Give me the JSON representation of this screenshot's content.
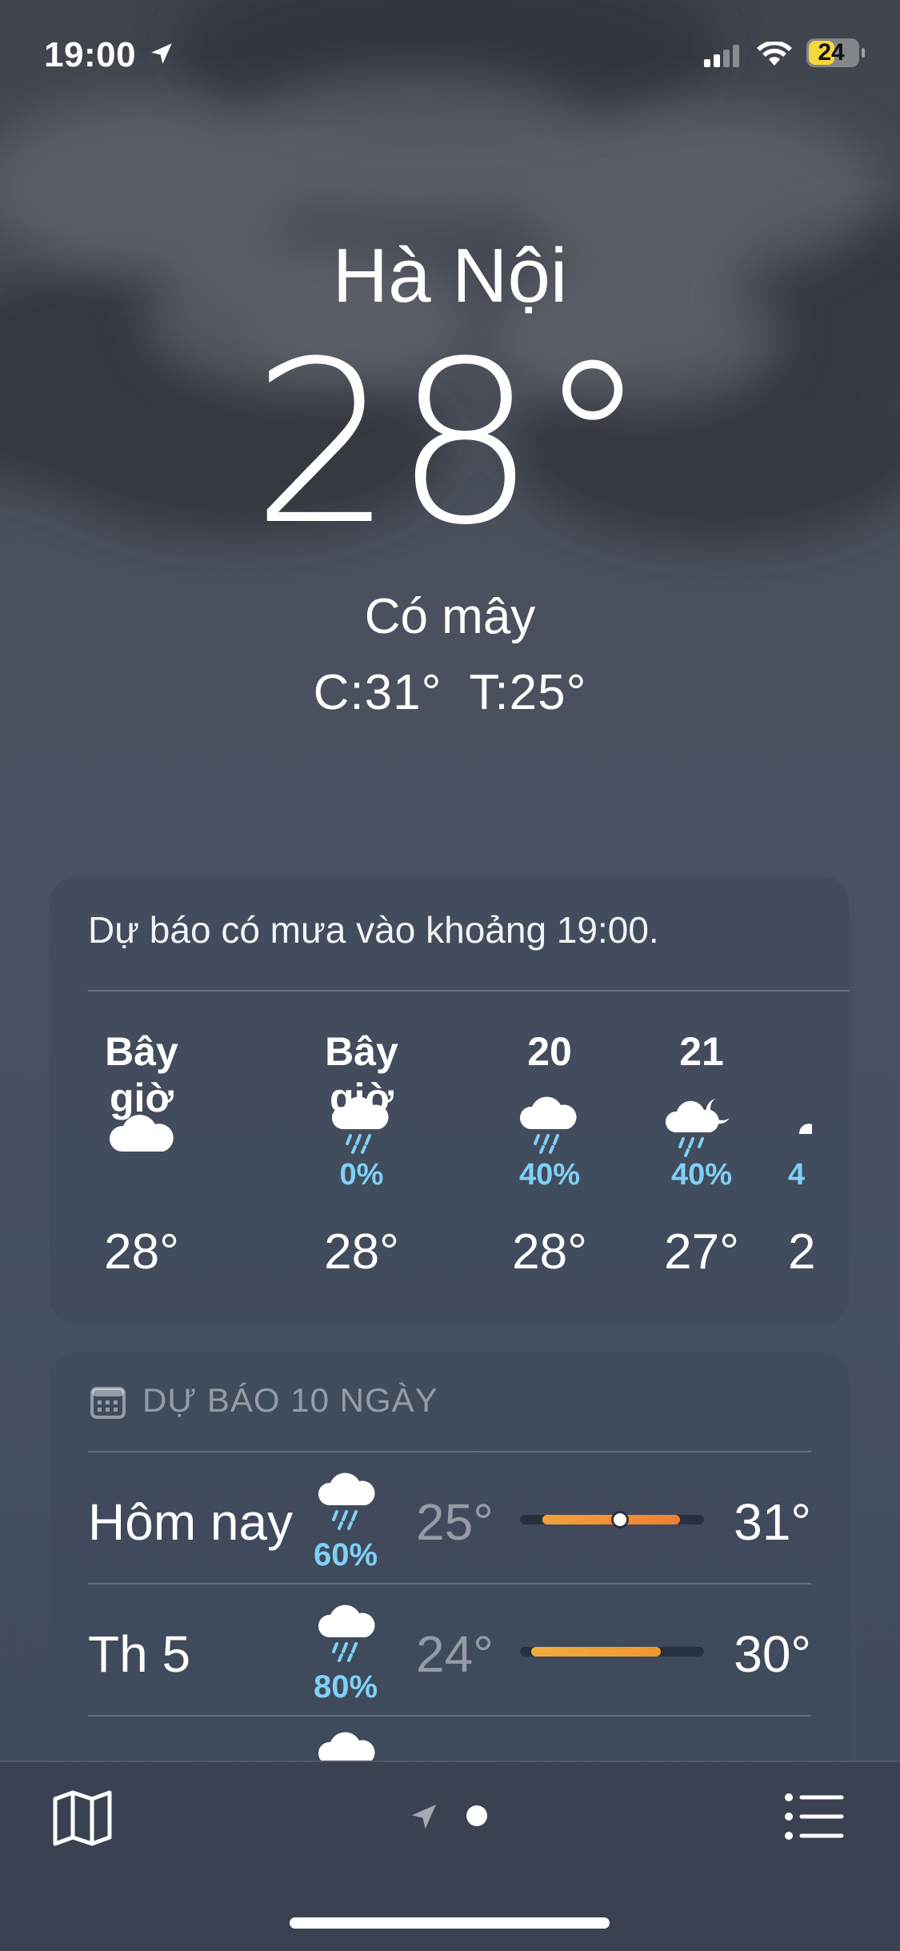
{
  "status_bar": {
    "time": "19:00",
    "battery": "24"
  },
  "location": {
    "city": "Hà Nội",
    "temperature": "28°",
    "condition": "Có mây",
    "high": "C:31°",
    "low": "T:25°"
  },
  "hourly_card": {
    "summary": "Dự báo có mưa vào khoảng 19:00.",
    "hours": [
      {
        "label": "Bây giờ",
        "icon": "cloud-icon",
        "precip": "",
        "temp": "28°"
      },
      {
        "label": "Bây giờ",
        "icon": "cloud-rain-icon",
        "precip": "0%",
        "temp": "28°"
      },
      {
        "label": "20",
        "icon": "cloud-rain-icon",
        "precip": "40%",
        "temp": "28°"
      },
      {
        "label": "21",
        "icon": "cloud-moon-rain-icon",
        "precip": "40%",
        "temp": "27°"
      },
      {
        "label": "",
        "icon": "cloud-moon-rain-icon",
        "precip": "4",
        "temp": "2"
      }
    ]
  },
  "daily_card": {
    "title": "DỰ BÁO 10 NGÀY",
    "days": [
      {
        "day": "Hôm nay",
        "icon": "cloud-rain-icon",
        "precip": "60%",
        "low": "25°",
        "high": "31°",
        "has_current_dot": true
      },
      {
        "day": "Th 5",
        "icon": "cloud-rain-icon",
        "precip": "80%",
        "low": "24°",
        "high": "30°",
        "has_current_dot": false
      },
      {
        "day": "",
        "icon": "cloud-rain-icon",
        "precip": "",
        "low": "",
        "high": "",
        "has_current_dot": false
      }
    ]
  },
  "colors": {
    "precip_blue": "#7fd0f6",
    "temp_bar_orange": "#f3a23a",
    "battery_yellow": "#f7d63c"
  }
}
